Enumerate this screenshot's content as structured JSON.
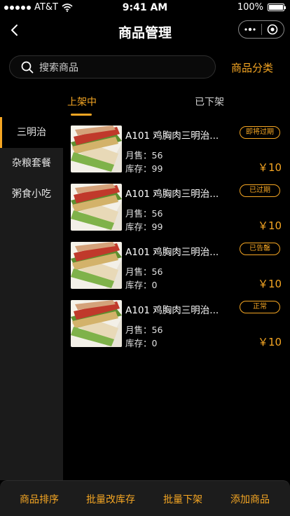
{
  "status": {
    "carrier": "AT&T",
    "time": "9:41 AM",
    "battery": "100%"
  },
  "nav": {
    "title": "商品管理"
  },
  "search": {
    "placeholder": "搜索商品",
    "category_label": "商品分类"
  },
  "tabs": [
    {
      "label": "上架中",
      "active": true
    },
    {
      "label": "已下架",
      "active": false
    }
  ],
  "sidebar": {
    "items": [
      {
        "label": "三明治",
        "active": true
      },
      {
        "label": "杂粮套餐"
      },
      {
        "label": "粥食小吃"
      }
    ]
  },
  "products": [
    {
      "name": "A101  鸡胸肉三明治...",
      "badge": "即将过期",
      "sales": "月售：56",
      "stock": "库存：99",
      "price": "￥10"
    },
    {
      "name": "A101  鸡胸肉三明治...",
      "badge": "已过期",
      "sales": "月售：56",
      "stock": "库存：99",
      "price": "￥10"
    },
    {
      "name": "A101  鸡胸肉三明治...",
      "badge": "已告罄",
      "sales": "月售：56",
      "stock": "库存：0",
      "price": "￥10"
    },
    {
      "name": "A101  鸡胸肉三明治...",
      "badge": "正常",
      "sales": "月售：56",
      "stock": "库存：0",
      "price": "￥10"
    }
  ],
  "actions": {
    "sort": "商品排序",
    "bulk_stock": "批量改库存",
    "bulk_off": "批量下架",
    "add": "添加商品"
  },
  "colors": {
    "accent": "#f5a623",
    "background": "#000000",
    "panel": "#1b1b1b"
  },
  "icons": {
    "back": "chevron-left-icon",
    "more": "more-dots-icon",
    "close": "target-icon",
    "search": "search-icon",
    "wifi": "wifi-icon",
    "battery": "battery-icon"
  }
}
